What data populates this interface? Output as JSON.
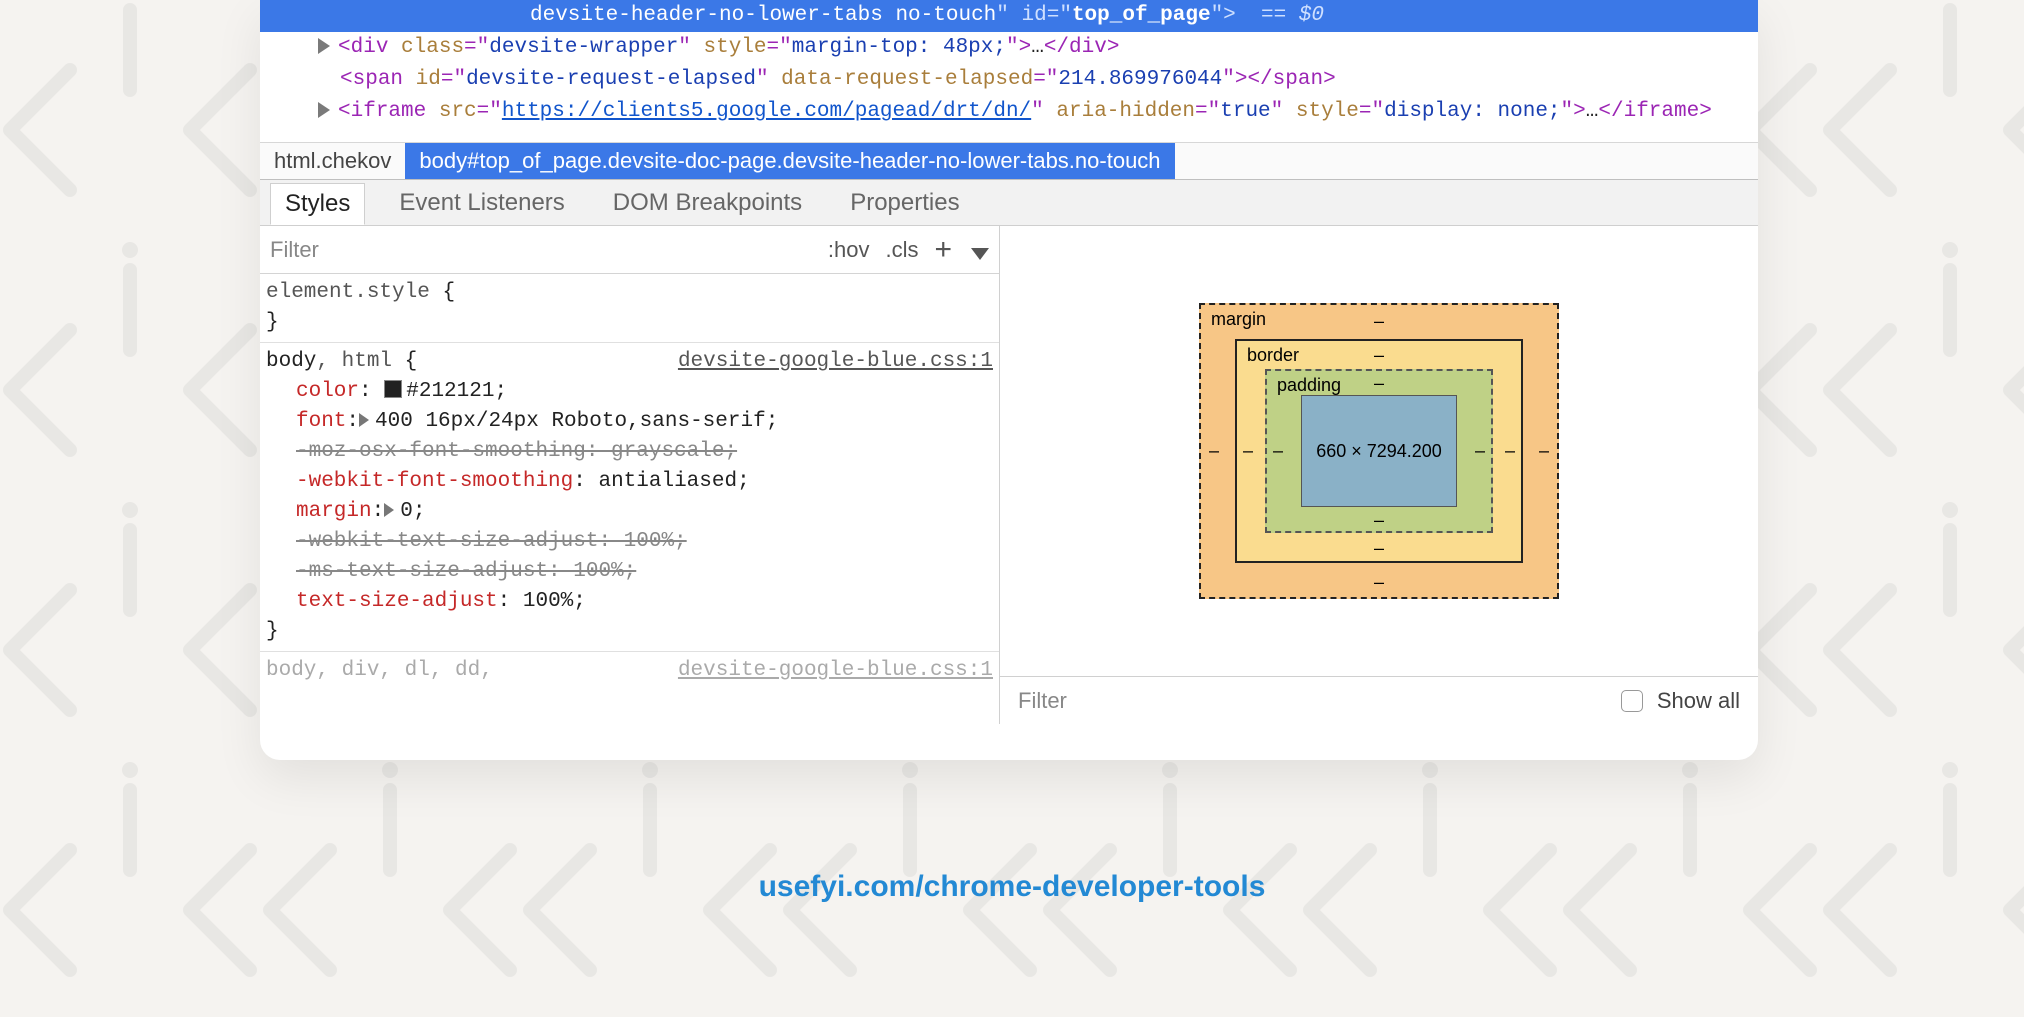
{
  "dom": {
    "selected_line": {
      "prefix": "devsite-header-no-lower-tabs no-touch",
      "id_attr": "id",
      "id_val": "top_of_page",
      "console": "== $0"
    },
    "row1": {
      "tag": "div",
      "attrs": "class=\"devsite-wrapper\" style=\"margin-top: 48px;\"",
      "tail": "…</div>"
    },
    "row2": {
      "tag": "span",
      "attrs": "id=\"devsite-request-elapsed\" data-request-elapsed=\"214.869976044\"",
      "tail": "</span>"
    },
    "row3": {
      "tag": "iframe",
      "src": "https://clients5.google.com/pagead/drt/dn/",
      "rest": "aria-hidden=\"true\" style=\"display: none;\"",
      "tail": "…</iframe>"
    }
  },
  "crumbs": {
    "c1": "html.chekov",
    "c2": "body#top_of_page.devsite-doc-page.devsite-header-no-lower-tabs.no-touch"
  },
  "tabs": {
    "styles": "Styles",
    "listeners": "Event Listeners",
    "dom_bp": "DOM Breakpoints",
    "props": "Properties"
  },
  "filter": {
    "placeholder": "Filter",
    "hov": ":hov",
    "cls": ".cls",
    "plus": "+"
  },
  "rules": {
    "r0_sel": "element.style",
    "r1_sel": "body, html",
    "r1_src": "devsite-google-blue.css:1",
    "p_color": "color",
    "v_color": "#212121",
    "p_font": "font",
    "v_font": "400 16px/24px Roboto,sans-serif",
    "p_moz": "-moz-osx-font-smoothing: grayscale;",
    "p_wfs": "-webkit-font-smoothing",
    "v_wfs": "antialiased",
    "p_margin": "margin",
    "v_margin": "0",
    "p_wtsa": "-webkit-text-size-adjust: 100%;",
    "p_mstsa": "-ms-text-size-adjust: 100%;",
    "p_tsa": "text-size-adjust",
    "v_tsa": "100%",
    "r2_sel": "body, div, dl, dd,",
    "r2_src": "devsite-google-blue.css:1"
  },
  "box": {
    "margin": "margin",
    "border": "border",
    "padding": "padding",
    "content": "660 × 7294.200",
    "dash": "–"
  },
  "right_filter": {
    "placeholder": "Filter",
    "show_all": "Show all"
  },
  "caption": "usefyi.com/chrome-developer-tools"
}
